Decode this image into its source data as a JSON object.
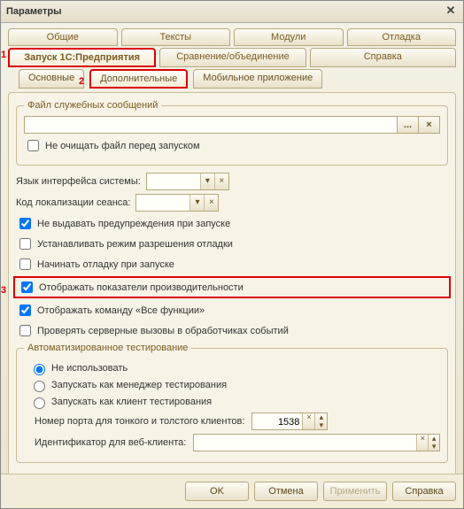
{
  "window": {
    "title": "Параметры"
  },
  "tabs_row1": [
    "Общие",
    "Тексты",
    "Модули",
    "Отладка"
  ],
  "tabs_row2": [
    "Запуск 1С:Предприятия",
    "Сравнение/объединение",
    "Справка"
  ],
  "subtabs": [
    "Основные",
    "Дополнительные",
    "Мобильное приложение"
  ],
  "active_tab_row2": 0,
  "active_subtab": 1,
  "markers": {
    "m1": "1",
    "m2": "2",
    "m3": "3"
  },
  "group_servicefile": {
    "legend": "Файл служебных сообщений",
    "path": "",
    "browse": "...",
    "clear_icon": "×",
    "noclear": "Не очищать файл перед запуском",
    "noclear_checked": false
  },
  "lang_label": "Язык интерфейса системы:",
  "lang_value": "",
  "loc_label": "Код локализации сеанса:",
  "loc_value": "",
  "chk_nowarn": {
    "label": "Не выдавать предупреждения при запуске",
    "checked": true
  },
  "chk_setdebug": {
    "label": "Устанавливать режим разрешения отладки",
    "checked": false
  },
  "chk_startdebug": {
    "label": "Начинать отладку при запуске",
    "checked": false
  },
  "chk_perf": {
    "label": "Отображать показатели производительности",
    "checked": true
  },
  "chk_allfunc": {
    "label": "Отображать команду «Все функции»",
    "checked": true
  },
  "chk_servcalls": {
    "label": "Проверять серверные вызовы в обработчиках событий",
    "checked": false
  },
  "group_autotest": {
    "legend": "Автоматизированное тестирование",
    "radios": [
      "Не использовать",
      "Запускать как менеджер тестирования",
      "Запускать как клиент тестирования"
    ],
    "selected": 0,
    "port_label": "Номер порта для тонкого и толстого клиентов:",
    "port_value": "1538",
    "webid_label": "Идентификатор для веб-клиента:",
    "webid_value": ""
  },
  "footer": {
    "ok": "OK",
    "cancel": "Отмена",
    "apply": "Применить",
    "help": "Справка"
  },
  "glyphs": {
    "dropdown": "▾",
    "clear": "×",
    "up": "▴",
    "down": "▾"
  }
}
